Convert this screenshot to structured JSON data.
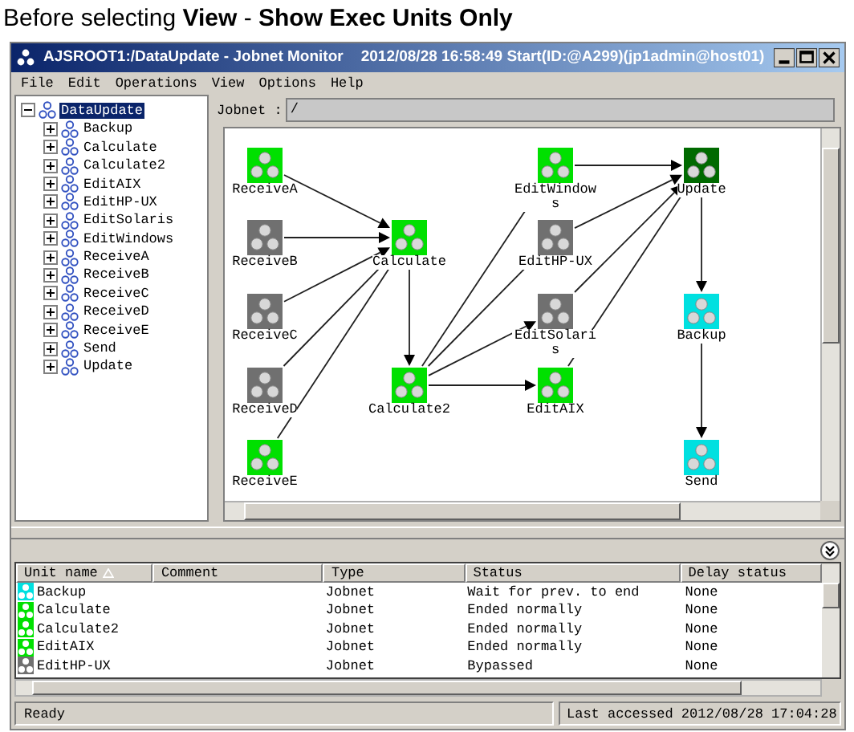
{
  "caption": "Before selecting **View** - **Show Exec Units Only**",
  "window": {
    "title": "AJSROOT1:/DataUpdate - Jobnet Monitor",
    "subtitle": "2012/08/28 16:58:49 Start(ID:@A299)(jp1admin@host01)"
  },
  "menu": [
    "File",
    "Edit",
    "Operations",
    "View",
    "Options",
    "Help"
  ],
  "tree": {
    "label": "DataUpdate",
    "expanded": true,
    "selected": true,
    "children": [
      {
        "label": "Backup",
        "expanded": false,
        "selected": false
      },
      {
        "label": "Calculate",
        "expanded": false,
        "selected": false
      },
      {
        "label": "Calculate2",
        "expanded": false,
        "selected": false
      },
      {
        "label": "EditAIX",
        "expanded": false,
        "selected": false
      },
      {
        "label": "EditHP-UX",
        "expanded": false,
        "selected": false
      },
      {
        "label": "EditSolaris",
        "expanded": false,
        "selected": false
      },
      {
        "label": "EditWindows",
        "expanded": false,
        "selected": false
      },
      {
        "label": "ReceiveA",
        "expanded": false,
        "selected": false
      },
      {
        "label": "ReceiveB",
        "expanded": false,
        "selected": false
      },
      {
        "label": "ReceiveC",
        "expanded": false,
        "selected": false
      },
      {
        "label": "ReceiveD",
        "expanded": false,
        "selected": false
      },
      {
        "label": "ReceiveE",
        "expanded": false,
        "selected": false
      },
      {
        "label": "Send",
        "expanded": false,
        "selected": false
      },
      {
        "label": "Update",
        "expanded": false,
        "selected": false
      }
    ]
  },
  "jobnet_field": {
    "label": "Jobnet :",
    "value": "/"
  },
  "nodes": [
    {
      "label": "ReceiveA",
      "color": "#00e000"
    },
    {
      "label": "ReceiveB",
      "color": "#707070"
    },
    {
      "label": "ReceiveC",
      "color": "#707070"
    },
    {
      "label": "ReceiveD",
      "color": "#707070"
    },
    {
      "label": "ReceiveE",
      "color": "#00e000"
    },
    {
      "label": "Calculate",
      "color": "#00e000"
    },
    {
      "label": "Calculate2",
      "color": "#00e000"
    },
    {
      "label": "EditWindows",
      "color": "#00e000"
    },
    {
      "label": "EditHP-UX",
      "color": "#707070"
    },
    {
      "label": "EditSolaris",
      "color": "#707070"
    },
    {
      "label": "EditAIX",
      "color": "#00e000"
    },
    {
      "label": "Update",
      "color": "#006a00"
    },
    {
      "label": "Backup",
      "color": "#00e0e0"
    },
    {
      "label": "Send",
      "color": "#00e0e0"
    }
  ],
  "table": {
    "columns": [
      "Unit name",
      "Comment",
      "Type",
      "Status",
      "Delay status"
    ],
    "rows": [
      {
        "name": "Backup",
        "color": "#00e0e0",
        "type": "Jobnet",
        "status": "Wait for prev. to end",
        "delay": "None"
      },
      {
        "name": "Calculate",
        "color": "#00e000",
        "type": "Jobnet",
        "status": "Ended normally",
        "delay": "None"
      },
      {
        "name": "Calculate2",
        "color": "#00e000",
        "type": "Jobnet",
        "status": "Ended normally",
        "delay": "None"
      },
      {
        "name": "EditAIX",
        "color": "#00e000",
        "type": "Jobnet",
        "status": "Ended normally",
        "delay": "None"
      },
      {
        "name": "EditHP-UX",
        "color": "#707070",
        "type": "Jobnet",
        "status": "Bypassed",
        "delay": "None"
      }
    ]
  },
  "status_bar": {
    "left": "Ready",
    "right": "Last accessed 2012/08/28 17:04:28"
  }
}
